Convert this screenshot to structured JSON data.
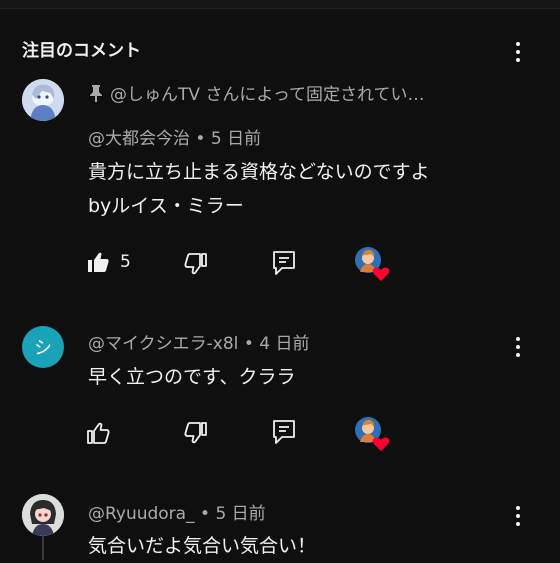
{
  "section": {
    "title": "注目のコメント"
  },
  "pinned": {
    "label": "@しゅんTV さんによって固定されてい…"
  },
  "comments": [
    {
      "author": "@大都会今治",
      "separator": "•",
      "time": "5 日前",
      "lines": [
        "貴方に立ち止まる資格などないのですよ",
        "byルイス・ミラー"
      ],
      "likes": "5",
      "liked": true
    },
    {
      "author": "@マイクシエラ-x8l",
      "separator": "•",
      "time": "4 日前",
      "avatar_letter": "シ",
      "avatar_color": "#1aa3b8",
      "lines": [
        "早く立つのです、クララ"
      ],
      "likes": "",
      "liked": false
    },
    {
      "author": "@Ryuudora_",
      "separator": "•",
      "time": "5 日前",
      "lines": [
        "気合いだよ気合い気合い！"
      ]
    }
  ],
  "colors": {
    "heart": "#ff0033",
    "background": "#0f0f0f",
    "meta": "#aaaaaa"
  }
}
